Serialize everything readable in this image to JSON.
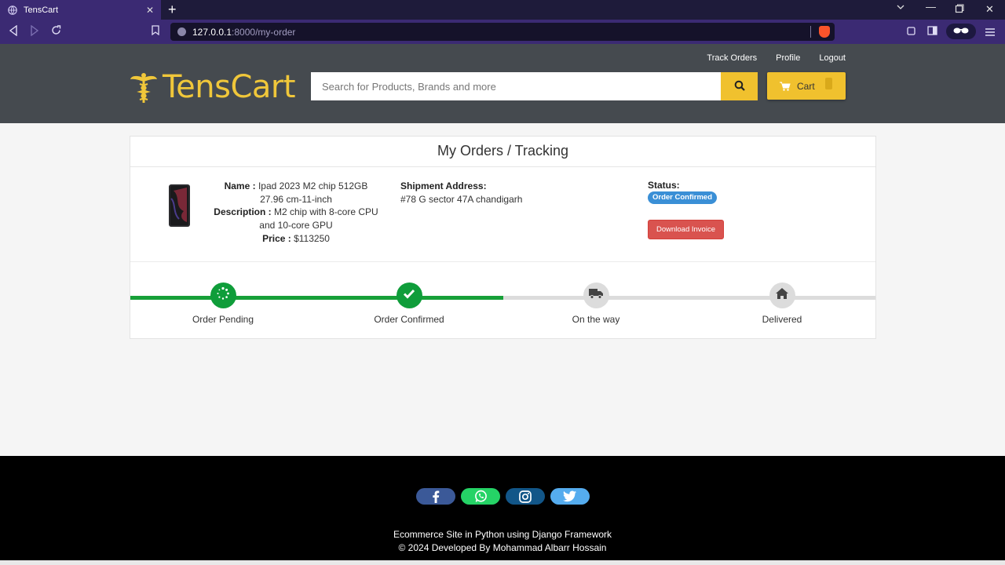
{
  "browser": {
    "tab_title": "TensCart",
    "url_host": "127.0.0.1",
    "url_path": ":8000/my-order"
  },
  "header": {
    "links": [
      "Track Orders",
      "Profile",
      "Logout"
    ],
    "logo_text": "TensCart",
    "search_placeholder": "Search for Products, Brands and more",
    "cart_label": "Cart",
    "brand_color": "#f0c12e"
  },
  "order": {
    "heading": "My Orders / Tracking",
    "name_label": "Name :",
    "name_value": "Ipad 2023 M2 chip 512GB 27.96 cm-11-inch",
    "description_label": "Description :",
    "description_value": "M2 chip with 8-core CPU and 10-core GPU",
    "price_label": "Price :",
    "price_value": "$113250",
    "shipment_label": "Shipment Address:",
    "shipment_value": "#78 G sector 47A chandigarh",
    "status_label": "Status:",
    "status_value": "Order Confirmed",
    "invoice_button": "Download Invoice"
  },
  "tracking": {
    "steps": [
      {
        "label": "Order Pending",
        "icon": "spinner-icon",
        "done": true
      },
      {
        "label": "Order Confirmed",
        "icon": "check-icon",
        "done": true
      },
      {
        "label": "On the way",
        "icon": "truck-icon",
        "done": false
      },
      {
        "label": "Delivered",
        "icon": "home-icon",
        "done": false
      }
    ],
    "progress_fraction": 0.5,
    "done_color": "#17a038",
    "todo_color": "#dcdcdc"
  },
  "footer": {
    "socials": [
      {
        "icon": "facebook-icon",
        "color": "#3b5998"
      },
      {
        "icon": "whatsapp-icon",
        "color": "#25d366"
      },
      {
        "icon": "instagram-icon",
        "color": "#125688"
      },
      {
        "icon": "twitter-icon",
        "color": "#55acee"
      }
    ],
    "line1": "Ecommerce Site in Python using Django Framework",
    "line2": "© 2024 Developed By Mohammad Albarr Hossain"
  }
}
